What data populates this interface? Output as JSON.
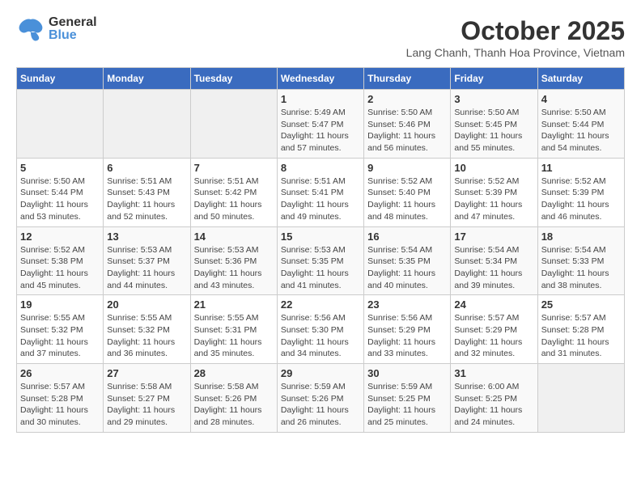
{
  "logo": {
    "general": "General",
    "blue": "Blue"
  },
  "title": "October 2025",
  "subtitle": "Lang Chanh, Thanh Hoa Province, Vietnam",
  "days_of_week": [
    "Sunday",
    "Monday",
    "Tuesday",
    "Wednesday",
    "Thursday",
    "Friday",
    "Saturday"
  ],
  "weeks": [
    [
      {
        "day": "",
        "info": ""
      },
      {
        "day": "",
        "info": ""
      },
      {
        "day": "",
        "info": ""
      },
      {
        "day": "1",
        "info": "Sunrise: 5:49 AM\nSunset: 5:47 PM\nDaylight: 11 hours and 57 minutes."
      },
      {
        "day": "2",
        "info": "Sunrise: 5:50 AM\nSunset: 5:46 PM\nDaylight: 11 hours and 56 minutes."
      },
      {
        "day": "3",
        "info": "Sunrise: 5:50 AM\nSunset: 5:45 PM\nDaylight: 11 hours and 55 minutes."
      },
      {
        "day": "4",
        "info": "Sunrise: 5:50 AM\nSunset: 5:44 PM\nDaylight: 11 hours and 54 minutes."
      }
    ],
    [
      {
        "day": "5",
        "info": "Sunrise: 5:50 AM\nSunset: 5:44 PM\nDaylight: 11 hours and 53 minutes."
      },
      {
        "day": "6",
        "info": "Sunrise: 5:51 AM\nSunset: 5:43 PM\nDaylight: 11 hours and 52 minutes."
      },
      {
        "day": "7",
        "info": "Sunrise: 5:51 AM\nSunset: 5:42 PM\nDaylight: 11 hours and 50 minutes."
      },
      {
        "day": "8",
        "info": "Sunrise: 5:51 AM\nSunset: 5:41 PM\nDaylight: 11 hours and 49 minutes."
      },
      {
        "day": "9",
        "info": "Sunrise: 5:52 AM\nSunset: 5:40 PM\nDaylight: 11 hours and 48 minutes."
      },
      {
        "day": "10",
        "info": "Sunrise: 5:52 AM\nSunset: 5:39 PM\nDaylight: 11 hours and 47 minutes."
      },
      {
        "day": "11",
        "info": "Sunrise: 5:52 AM\nSunset: 5:39 PM\nDaylight: 11 hours and 46 minutes."
      }
    ],
    [
      {
        "day": "12",
        "info": "Sunrise: 5:52 AM\nSunset: 5:38 PM\nDaylight: 11 hours and 45 minutes."
      },
      {
        "day": "13",
        "info": "Sunrise: 5:53 AM\nSunset: 5:37 PM\nDaylight: 11 hours and 44 minutes."
      },
      {
        "day": "14",
        "info": "Sunrise: 5:53 AM\nSunset: 5:36 PM\nDaylight: 11 hours and 43 minutes."
      },
      {
        "day": "15",
        "info": "Sunrise: 5:53 AM\nSunset: 5:35 PM\nDaylight: 11 hours and 41 minutes."
      },
      {
        "day": "16",
        "info": "Sunrise: 5:54 AM\nSunset: 5:35 PM\nDaylight: 11 hours and 40 minutes."
      },
      {
        "day": "17",
        "info": "Sunrise: 5:54 AM\nSunset: 5:34 PM\nDaylight: 11 hours and 39 minutes."
      },
      {
        "day": "18",
        "info": "Sunrise: 5:54 AM\nSunset: 5:33 PM\nDaylight: 11 hours and 38 minutes."
      }
    ],
    [
      {
        "day": "19",
        "info": "Sunrise: 5:55 AM\nSunset: 5:32 PM\nDaylight: 11 hours and 37 minutes."
      },
      {
        "day": "20",
        "info": "Sunrise: 5:55 AM\nSunset: 5:32 PM\nDaylight: 11 hours and 36 minutes."
      },
      {
        "day": "21",
        "info": "Sunrise: 5:55 AM\nSunset: 5:31 PM\nDaylight: 11 hours and 35 minutes."
      },
      {
        "day": "22",
        "info": "Sunrise: 5:56 AM\nSunset: 5:30 PM\nDaylight: 11 hours and 34 minutes."
      },
      {
        "day": "23",
        "info": "Sunrise: 5:56 AM\nSunset: 5:29 PM\nDaylight: 11 hours and 33 minutes."
      },
      {
        "day": "24",
        "info": "Sunrise: 5:57 AM\nSunset: 5:29 PM\nDaylight: 11 hours and 32 minutes."
      },
      {
        "day": "25",
        "info": "Sunrise: 5:57 AM\nSunset: 5:28 PM\nDaylight: 11 hours and 31 minutes."
      }
    ],
    [
      {
        "day": "26",
        "info": "Sunrise: 5:57 AM\nSunset: 5:28 PM\nDaylight: 11 hours and 30 minutes."
      },
      {
        "day": "27",
        "info": "Sunrise: 5:58 AM\nSunset: 5:27 PM\nDaylight: 11 hours and 29 minutes."
      },
      {
        "day": "28",
        "info": "Sunrise: 5:58 AM\nSunset: 5:26 PM\nDaylight: 11 hours and 28 minutes."
      },
      {
        "day": "29",
        "info": "Sunrise: 5:59 AM\nSunset: 5:26 PM\nDaylight: 11 hours and 26 minutes."
      },
      {
        "day": "30",
        "info": "Sunrise: 5:59 AM\nSunset: 5:25 PM\nDaylight: 11 hours and 25 minutes."
      },
      {
        "day": "31",
        "info": "Sunrise: 6:00 AM\nSunset: 5:25 PM\nDaylight: 11 hours and 24 minutes."
      },
      {
        "day": "",
        "info": ""
      }
    ]
  ]
}
